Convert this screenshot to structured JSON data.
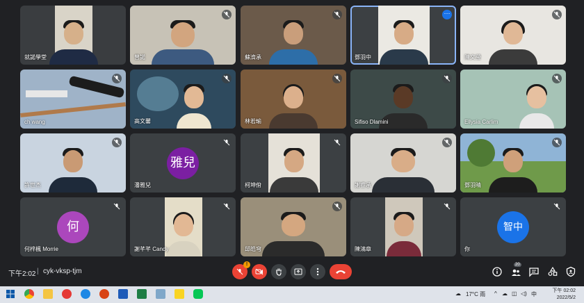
{
  "participants": [
    {
      "name": "就諾學堂",
      "mic_muted": false
    },
    {
      "name": "曾諾",
      "mic_muted": true
    },
    {
      "name": "蘇濟承",
      "mic_muted": true
    },
    {
      "name": "鄧羽中",
      "mic_muted": false,
      "active_speaker": true
    },
    {
      "name": "陳文瑩",
      "mic_muted": true
    },
    {
      "name": "ch wang",
      "mic_muted": true
    },
    {
      "name": "高文馨",
      "mic_muted": true
    },
    {
      "name": "林若瑜",
      "mic_muted": true
    },
    {
      "name": "Sifiso Dlamini",
      "mic_muted": true
    },
    {
      "name": "Ellysia Carlim",
      "mic_muted": true
    },
    {
      "name": "許世杰",
      "mic_muted": true
    },
    {
      "name": "潘雅兒",
      "mic_muted": true,
      "avatar_text": "雅兒",
      "avatar_color": "#7b1fa2"
    },
    {
      "name": "柯坤佾",
      "mic_muted": true
    },
    {
      "name": "謝睿承",
      "mic_muted": true
    },
    {
      "name": "鄧羽晴",
      "mic_muted": true
    },
    {
      "name": "何梓楓 Morrie",
      "mic_muted": true,
      "avatar_text": "何",
      "avatar_color": "#ab47bc"
    },
    {
      "name": "謝芊芊 Candy",
      "mic_muted": true
    },
    {
      "name": "邱皓穹",
      "mic_muted": true
    },
    {
      "name": "陳鴻章",
      "mic_muted": true
    },
    {
      "name": "你",
      "mic_muted": true,
      "avatar_text": "智中",
      "avatar_color": "#1a73e8"
    }
  ],
  "bottom_bar": {
    "time": "下午2:02",
    "separator": "|",
    "meeting_code": "cyk-vksp-tjm",
    "mic_badge": "!",
    "participant_count": "20"
  },
  "taskbar": {
    "weather": "17°C 雨",
    "ime": "中",
    "clock_time": "下午 02:02",
    "clock_date": "2022/5/2"
  },
  "colors": {
    "background": "#202124",
    "tile": "#3c4043",
    "end_call": "#ea4335",
    "active_outline": "#8ab4f8"
  }
}
